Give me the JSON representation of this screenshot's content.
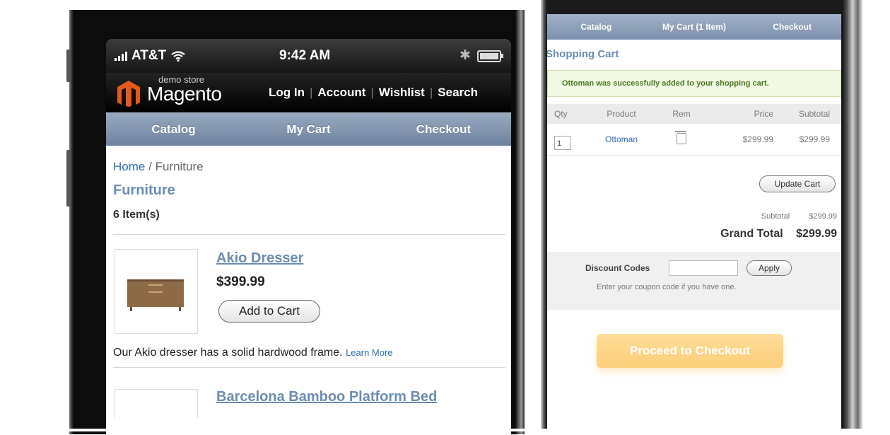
{
  "left_phone": {
    "status_bar": {
      "carrier": "AT&T",
      "time": "9:42 AM",
      "bluetooth": "✱"
    },
    "header": {
      "logo_small": "demo store",
      "logo_big": "Magento",
      "nav": [
        "Log In",
        "Account",
        "Wishlist",
        "Search"
      ]
    },
    "tabs": [
      "Catalog",
      "My Cart",
      "Checkout"
    ],
    "breadcrumb": {
      "home": "Home",
      "separator": "/",
      "current": "Furniture"
    },
    "category_title": "Furniture",
    "item_count": "6 Item(s)",
    "products": [
      {
        "name": "Akio Dresser",
        "price": "$399.99",
        "add_label": "Add to Cart",
        "description": "Our Akio dresser has a solid hardwood frame.",
        "learn_more": "Learn More"
      },
      {
        "name": "Barcelona Bamboo Platform Bed"
      }
    ]
  },
  "right_phone": {
    "tabs": [
      "Catalog",
      "My Cart (1 Item)",
      "Checkout"
    ],
    "title": "Shopping Cart",
    "success_message": "Ottoman was successfully added to your shopping cart.",
    "table": {
      "headers": [
        "Qty",
        "Product",
        "Rem",
        "Price",
        "Subtotal"
      ],
      "rows": [
        {
          "qty": "1",
          "product": "Ottoman",
          "price": "$299.99",
          "subtotal": "$299.99"
        }
      ]
    },
    "update_label": "Update Cart",
    "subtotal_label": "Subtotal",
    "subtotal_value": "$299.99",
    "grand_total_label": "Grand Total",
    "grand_total_value": "$299.99",
    "discount": {
      "label": "Discount Codes",
      "input_value": "",
      "apply_label": "Apply",
      "hint": "Enter your coupon code if you have one."
    },
    "checkout_label": "Proceed to Checkout"
  },
  "colors": {
    "tab_bar": "#7d8fab",
    "link": "#2f6db4",
    "title_blue": "#6b8db2",
    "logo_orange": "#e5581b",
    "checkout_orange": "#fbbd4a",
    "success_bg": "#f1f8e4"
  }
}
